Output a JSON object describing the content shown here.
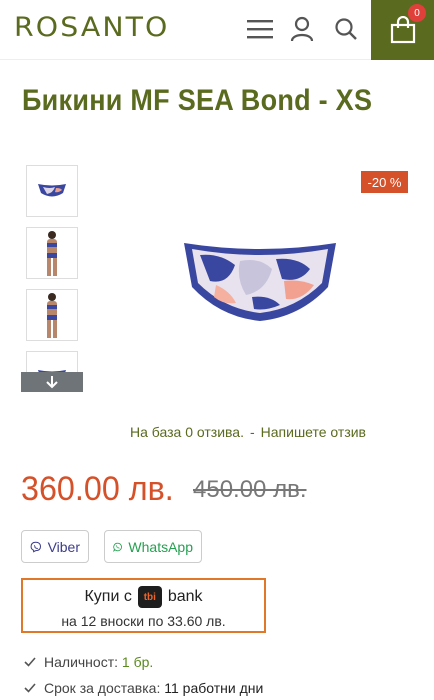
{
  "header": {
    "logo": "ROSANTO",
    "cart_count": "0",
    "menu_icon": "hamburger-icon",
    "user_icon": "user-icon",
    "search_icon": "search-icon",
    "cart_icon": "shopping-bag-icon"
  },
  "product": {
    "title": "Бикини MF SEA Bond - XS",
    "discount_badge": "-20 %",
    "reviews_text": "На база 0 отзива.",
    "reviews_separator": "-",
    "write_review": "Напишете отзив",
    "price": "360.00 лв.",
    "old_price": "450.00 лв."
  },
  "share": {
    "viber": "Viber",
    "whatsapp": "WhatsApp"
  },
  "tbi": {
    "buy_with": "Купи с",
    "logo_text": "tbi",
    "bank": "bank",
    "installments": "на 12 вноски по 33.60 лв."
  },
  "info": {
    "availability_label": "Наличност:",
    "availability_value": "1 бр.",
    "delivery_label": "Срок за доставка:",
    "delivery_value": "11 работни дни"
  },
  "colors": {
    "brand": "#5a6a1e",
    "accent": "#d5512a",
    "tbi_border": "#e0782a"
  }
}
